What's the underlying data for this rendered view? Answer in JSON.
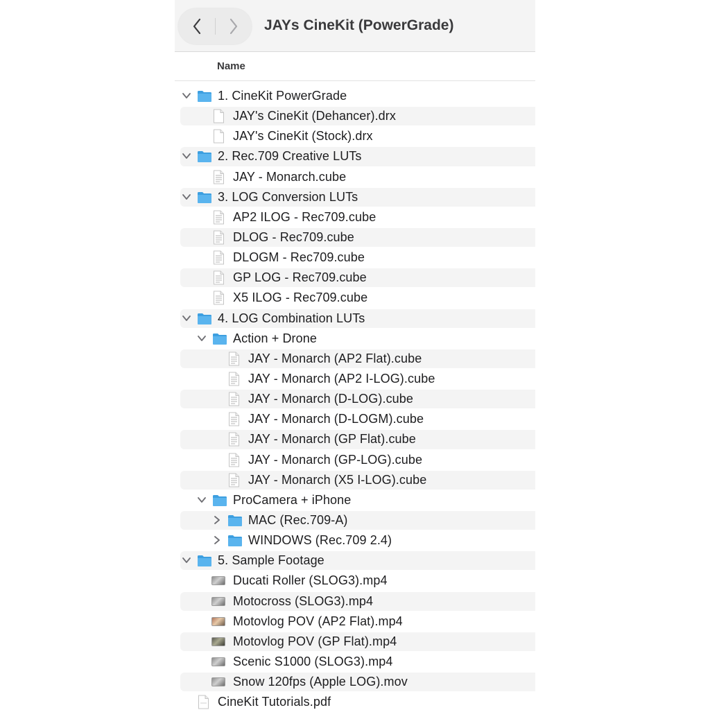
{
  "window": {
    "title": "JAYs CineKit (PowerGrade)",
    "nav": {
      "back_icon": "chevron-left-icon",
      "forward_icon": "chevron-right-icon"
    }
  },
  "header": {
    "name_column": "Name"
  },
  "rows": [
    {
      "label": "1. CineKit PowerGrade",
      "depth": 0,
      "kind": "folder",
      "disclosure": "open"
    },
    {
      "label": "JAY's CineKit (Dehancer).drx",
      "depth": 1,
      "kind": "blank"
    },
    {
      "label": "JAY's CineKit (Stock).drx",
      "depth": 1,
      "kind": "blank"
    },
    {
      "label": "2. Rec.709 Creative LUTs",
      "depth": 0,
      "kind": "folder",
      "disclosure": "open"
    },
    {
      "label": "JAY - Monarch.cube",
      "depth": 1,
      "kind": "text"
    },
    {
      "label": "3. LOG Conversion LUTs",
      "depth": 0,
      "kind": "folder",
      "disclosure": "open"
    },
    {
      "label": "AP2 ILOG - Rec709.cube",
      "depth": 1,
      "kind": "text"
    },
    {
      "label": "DLOG - Rec709.cube",
      "depth": 1,
      "kind": "text"
    },
    {
      "label": "DLOGM - Rec709.cube",
      "depth": 1,
      "kind": "text"
    },
    {
      "label": "GP LOG - Rec709.cube",
      "depth": 1,
      "kind": "text"
    },
    {
      "label": "X5 ILOG - Rec709.cube",
      "depth": 1,
      "kind": "text"
    },
    {
      "label": "4. LOG Combination LUTs",
      "depth": 0,
      "kind": "folder",
      "disclosure": "open"
    },
    {
      "label": "Action + Drone",
      "depth": 1,
      "kind": "folder",
      "disclosure": "open"
    },
    {
      "label": "JAY - Monarch (AP2 Flat).cube",
      "depth": 2,
      "kind": "text"
    },
    {
      "label": "JAY - Monarch (AP2 I-LOG).cube",
      "depth": 2,
      "kind": "text"
    },
    {
      "label": "JAY - Monarch (D-LOG).cube",
      "depth": 2,
      "kind": "text"
    },
    {
      "label": "JAY - Monarch (D-LOGM).cube",
      "depth": 2,
      "kind": "text"
    },
    {
      "label": "JAY - Monarch (GP Flat).cube",
      "depth": 2,
      "kind": "text"
    },
    {
      "label": "JAY - Monarch (GP-LOG).cube",
      "depth": 2,
      "kind": "text"
    },
    {
      "label": "JAY - Monarch (X5 I-LOG).cube",
      "depth": 2,
      "kind": "text"
    },
    {
      "label": "ProCamera + iPhone",
      "depth": 1,
      "kind": "folder",
      "disclosure": "open"
    },
    {
      "label": "MAC (Rec.709-A)",
      "depth": 2,
      "kind": "folder",
      "disclosure": "closed"
    },
    {
      "label": "WINDOWS (Rec.709 2.4)",
      "depth": 2,
      "kind": "folder",
      "disclosure": "closed"
    },
    {
      "label": "5. Sample Footage",
      "depth": 0,
      "kind": "folder",
      "disclosure": "open"
    },
    {
      "label": "Ducati Roller (SLOG3).mp4",
      "depth": 1,
      "kind": "video",
      "tone": "grey"
    },
    {
      "label": "Motocross (SLOG3).mp4",
      "depth": 1,
      "kind": "video",
      "tone": "grey"
    },
    {
      "label": "Motovlog POV (AP2 Flat).mp4",
      "depth": 1,
      "kind": "video",
      "tone": "warm"
    },
    {
      "label": "Motovlog POV (GP Flat).mp4",
      "depth": 1,
      "kind": "video",
      "tone": "dark"
    },
    {
      "label": "Scenic S1000 (SLOG3).mp4",
      "depth": 1,
      "kind": "video",
      "tone": "grey"
    },
    {
      "label": "Snow 120fps (Apple LOG).mov",
      "depth": 1,
      "kind": "video",
      "tone": "grey"
    },
    {
      "label": "CineKit Tutorials.pdf",
      "depth": 0,
      "kind": "pdf"
    }
  ],
  "colors": {
    "folder": "#5ab4ee",
    "folder_tab": "#3d9fe0",
    "stripe": "#f4f4f4",
    "text": "#1d1d1f"
  }
}
